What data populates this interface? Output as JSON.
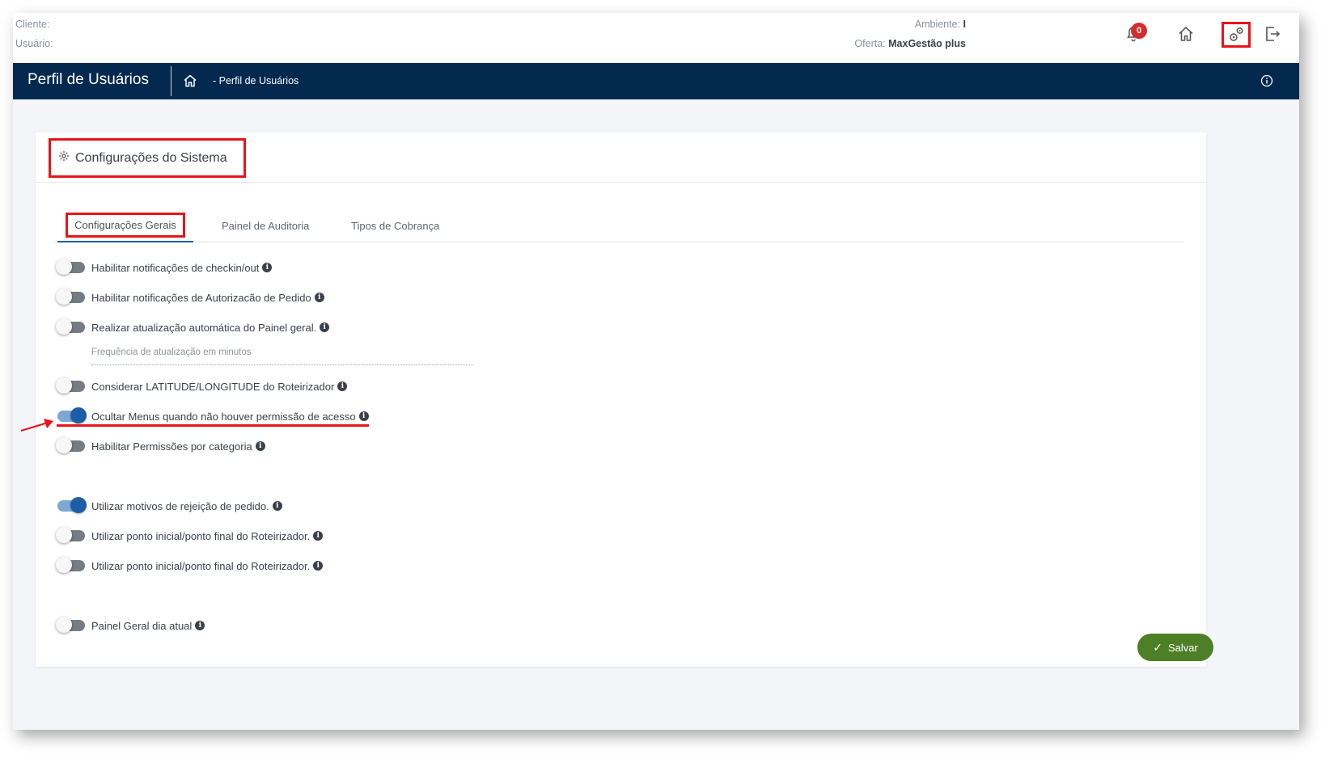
{
  "topbar": {
    "client_label": "Cliente:",
    "user_label": "Usuário:",
    "environment_label": "Ambiente:",
    "environment_value": "I",
    "offer_label": "Oferta:",
    "offer_value": "MaxGestão plus",
    "notification_count": "0"
  },
  "navbar": {
    "title": "Perfil de Usuários",
    "breadcrumb": "- Perfil de Usuários"
  },
  "card": {
    "title": "Configurações do Sistema",
    "tabs": [
      {
        "label": "Configurações Gerais",
        "active": true
      },
      {
        "label": "Painel de Auditoria",
        "active": false
      },
      {
        "label": "Tipos de Cobrança",
        "active": false
      }
    ],
    "settings": [
      {
        "label": "Habilitar notificações de checkin/out",
        "enabled": false
      },
      {
        "label": "Habilitar notificações de Autorizacão de Pedido",
        "enabled": false
      },
      {
        "label": "Realizar atualização automática do Painel geral.",
        "enabled": false
      },
      {
        "label": "Considerar LATITUDE/LONGITUDE do Roteirizador",
        "enabled": false
      },
      {
        "label": "Ocultar Menus quando não houver permissão de acesso",
        "enabled": true
      },
      {
        "label": "Habilitar Permissões por categoria",
        "enabled": false
      },
      {
        "label": "Utilizar motivos de rejeição de pedido.",
        "enabled": true
      },
      {
        "label": "Utilizar ponto inicial/ponto final do Roteirizador.",
        "enabled": false
      },
      {
        "label": "Utilizar ponto inicial/ponto final do Roteirizador.",
        "enabled": false
      },
      {
        "label": "Painel Geral dia atual",
        "enabled": false
      }
    ],
    "frequency_placeholder": "Frequência de atualização em minutos",
    "save_label": "Salvar"
  },
  "colors": {
    "navbar": "#04294f",
    "accent": "#1d5fa6",
    "save": "#4d8026",
    "highlight": "#e8141a"
  }
}
